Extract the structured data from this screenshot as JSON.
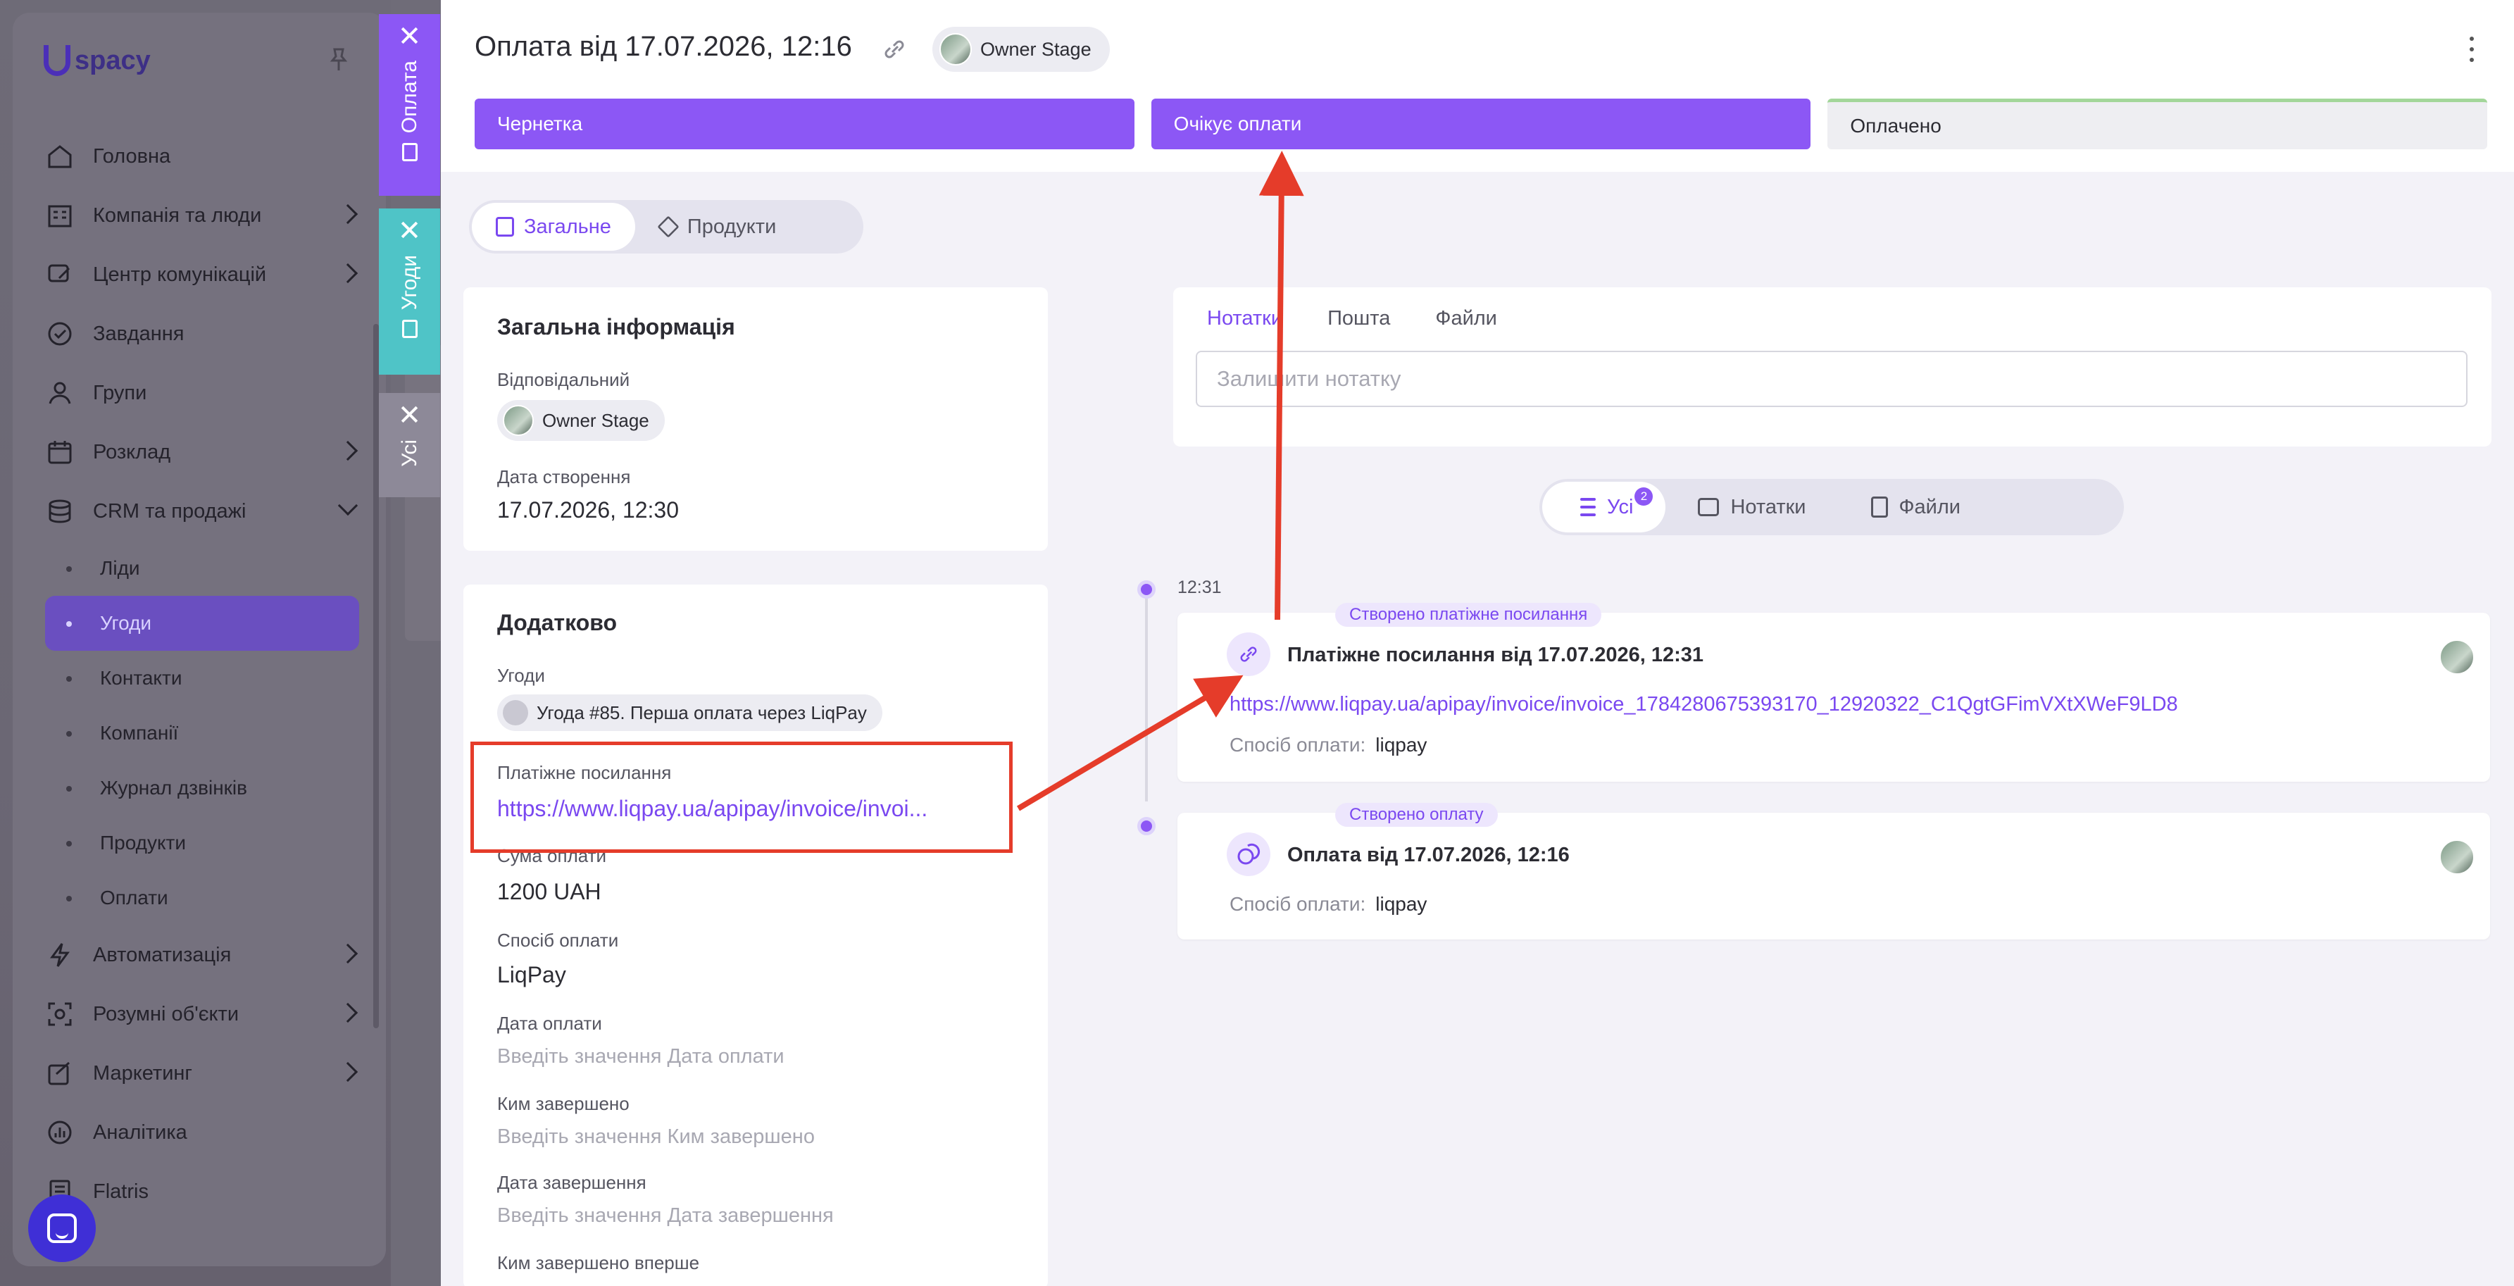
{
  "brand": {
    "logo_text": "spacy",
    "accent": "#8c57f5"
  },
  "sidebar": {
    "items": [
      {
        "label": "Головна",
        "icon": "home-icon"
      },
      {
        "label": "Компанія та люди",
        "icon": "building-icon"
      },
      {
        "label": "Центр комунікацій",
        "icon": "chat-edit-icon"
      },
      {
        "label": "Завдання",
        "icon": "check-circle-icon"
      },
      {
        "label": "Групи",
        "icon": "user-icon"
      },
      {
        "label": "Розклад",
        "icon": "calendar-icon"
      },
      {
        "label": "CRM та продажі",
        "icon": "database-icon"
      }
    ],
    "crm_sub": [
      "Ліди",
      "Угоди",
      "Контакти",
      "Компанії",
      "Журнал дзвінків",
      "Продукти",
      "Оплати"
    ],
    "items_after": [
      {
        "label": "Автоматизація",
        "icon": "lightning-icon"
      },
      {
        "label": "Розумні об'єкти",
        "icon": "smart-object-icon"
      },
      {
        "label": "Маркетинг",
        "icon": "marketing-icon"
      },
      {
        "label": "Аналітика",
        "icon": "analytics-icon"
      },
      {
        "label": "Flatris",
        "icon": "flatris-icon"
      }
    ]
  },
  "vertical_tabs": {
    "payment": "Оплата",
    "deals": "Угоди",
    "all": "Усі"
  },
  "header": {
    "title": "Оплата від 17.07.2026, 12:16",
    "owner": "Owner Stage"
  },
  "stages": [
    "Чернетка",
    "Очікує оплати",
    "Оплачено"
  ],
  "view_tabs": {
    "general": "Загальне",
    "products": "Продукти"
  },
  "general_info": {
    "heading": "Загальна інформація",
    "responsible_label": "Відповідальний",
    "responsible": "Owner Stage",
    "created_label": "Дата створення",
    "created": "17.07.2026, 12:30"
  },
  "extra": {
    "heading": "Додатково",
    "deals_label": "Угоди",
    "deal": "Угода #85. Перша оплата через LiqPay",
    "link_label": "Платіжне посилання",
    "link": "https://www.liqpay.ua/apipay/invoice/invoi...",
    "amount_label": "Сума оплати",
    "amount": "1200 UAH",
    "method_label": "Спосіб оплати",
    "method": "LiqPay",
    "pay_date_label": "Дата оплати",
    "pay_date_ph": "Введіть значення Дата оплати",
    "completed_by_label": "Ким завершено",
    "completed_by_ph": "Введіть значення Ким завершено",
    "completed_date_label": "Дата завершення",
    "completed_date_ph": "Введіть значення Дата завершення",
    "first_completed_label": "Ким завершено вперше"
  },
  "notes": {
    "tabs": [
      "Нотатки",
      "Пошта",
      "Файли"
    ],
    "placeholder": "Залишити нотатку"
  },
  "feed_filter": {
    "all": "Усі",
    "all_count": "2",
    "notes": "Нотатки",
    "files": "Файли"
  },
  "timeline": {
    "time": "12:31",
    "events": [
      {
        "tag": "Створено платіжне посилання",
        "title": "Платіжне посилання від 17.07.2026, 12:31",
        "link": "https://www.liqpay.ua/apipay/invoice/invoice_1784280675393170_12920322_C1QgtGFimVXtXWeF9LD8",
        "method_label": "Спосіб оплати:",
        "method": "liqpay"
      },
      {
        "tag": "Створено оплату",
        "title": "Оплата від 17.07.2026, 12:16",
        "method_label": "Спосіб оплати:",
        "method": "liqpay"
      }
    ]
  },
  "annotation_color": "#e53c2a"
}
